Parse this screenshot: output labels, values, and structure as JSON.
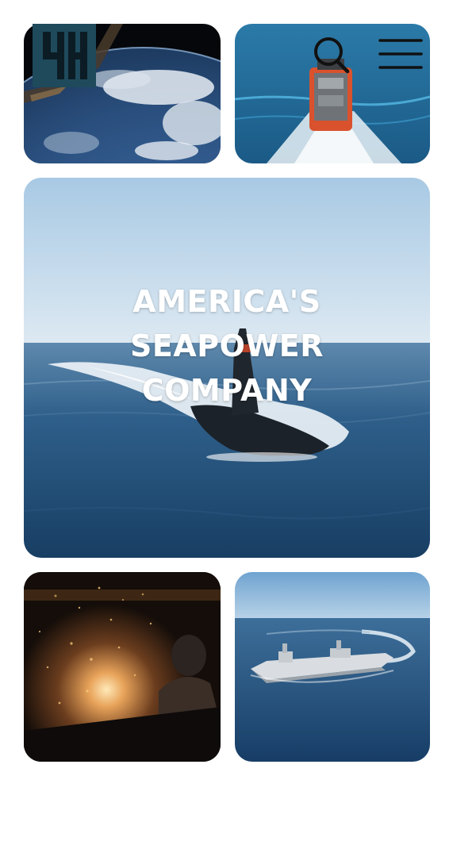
{
  "header": {
    "logo_icon": "company-logo",
    "search_icon": "search-icon",
    "menu_icon": "hamburger-menu-icon",
    "icon_color": "#111111",
    "logo_color": "#1e4a5c"
  },
  "hero": {
    "title_lines": [
      "AMERICA'S",
      "SEAPOWER",
      "COMPANY"
    ]
  },
  "tiles": [
    {
      "name": "earth-from-space-image"
    },
    {
      "name": "patrol-boat-image"
    },
    {
      "name": "submarine-hero-image"
    },
    {
      "name": "welder-sparks-image"
    },
    {
      "name": "amphibious-ship-image"
    }
  ]
}
